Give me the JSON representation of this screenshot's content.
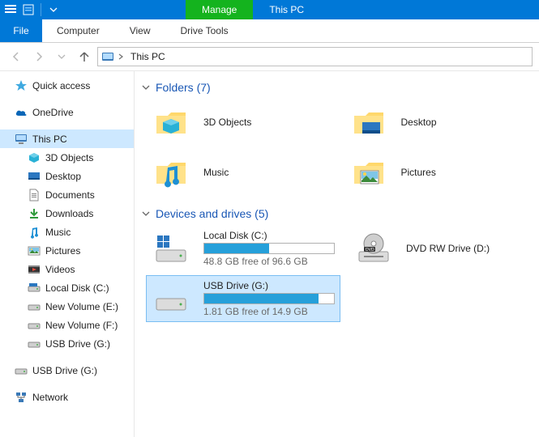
{
  "title_context": {
    "manage": "Manage",
    "thispc": "This PC"
  },
  "tabs": {
    "file": "File",
    "computer": "Computer",
    "view": "View",
    "drivetools": "Drive Tools"
  },
  "breadcrumb": {
    "current": "This PC"
  },
  "nav": {
    "quick_access": "Quick access",
    "onedrive": "OneDrive",
    "this_pc": "This PC",
    "children": {
      "obj3d": "3D Objects",
      "desktop": "Desktop",
      "documents": "Documents",
      "downloads": "Downloads",
      "music": "Music",
      "pictures": "Pictures",
      "videos": "Videos",
      "localdisk": "Local Disk (C:)",
      "newvolE": "New Volume (E:)",
      "newvolF": "New Volume (F:)",
      "usbG1": "USB Drive (G:)",
      "usbG2": "USB Drive (G:)"
    },
    "network": "Network"
  },
  "sections": {
    "folders": {
      "title": "Folders (7)"
    },
    "drives": {
      "title": "Devices and drives (5)"
    }
  },
  "folders": {
    "obj3d": "3D Objects",
    "desktop": "Desktop",
    "music": "Music",
    "pictures": "Pictures"
  },
  "drives": {
    "localdisk": {
      "name": "Local Disk (C:)",
      "sub": "48.8 GB free of 96.6 GB",
      "fill_pct": 50
    },
    "dvd": {
      "name": "DVD RW Drive (D:)"
    },
    "usb": {
      "name": "USB Drive (G:)",
      "sub": "1.81 GB free of 14.9 GB",
      "fill_pct": 88
    }
  }
}
